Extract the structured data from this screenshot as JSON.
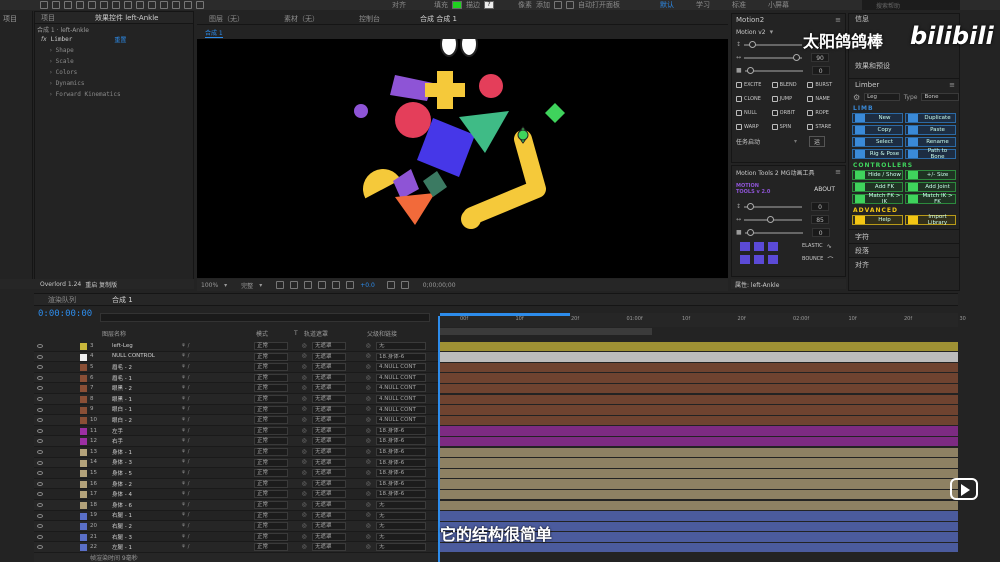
{
  "toolbar": {
    "align_label": "对齐",
    "fill_label": "填充",
    "stroke_label": "描边",
    "stroke_value": "?",
    "pixel_label": "像素",
    "add_label": "添加",
    "auto_open_label": "自动打开面板",
    "workspace_default": "默认",
    "workspace_learn": "学习",
    "workspace_standard": "标准",
    "workspace_small": "小屏幕",
    "search_placeholder": "搜索帮助",
    "fill_color": "#1fd31f"
  },
  "project_panel": {
    "tab_project": "项目",
    "tab_effects": "效果控件 left-Ankle",
    "breadcrumb": "合成 1 · left-Ankle",
    "fx_name": "Limber",
    "reset_label": "重置",
    "groups": [
      "Shape",
      "Scale",
      "Colors",
      "Dynamics",
      "Forward Kinematics"
    ]
  },
  "viewer_tabs": {
    "layer": "图层（无）",
    "footage": "素材（无）",
    "console": "控制台",
    "comp": "合成 合成 1",
    "comp_chip": "合成 1"
  },
  "viewer_bar": {
    "zoom": "100%",
    "quality": "完整",
    "exposure": "+0.0",
    "timecode": "0;00;00;00"
  },
  "overlord": {
    "label": "Overlord 1.24",
    "label2": "重启 复制版"
  },
  "motion2": {
    "title": "Motion2",
    "preset": "Motion v2",
    "values": [
      "0",
      "90",
      "0"
    ],
    "buttons": [
      "EXCITE",
      "BLEND",
      "BURST",
      "CLONE",
      "JUMP",
      "NAME",
      "NULL",
      "ORBIT",
      "ROPE",
      "WARP",
      "SPIN",
      "STARE"
    ],
    "task_label": "任务启动",
    "task_button": "运"
  },
  "mt2": {
    "title": "Motion Tools 2 MG动画工具",
    "logo_line1": "MOTION",
    "logo_line2": "TOOLS v 2.0",
    "about": "ABOUT",
    "values": [
      "0",
      "85",
      "0"
    ],
    "elastic": "ELASTIC",
    "bounce": "BOUNCE",
    "footer": "属性: left-Ankle"
  },
  "right_column": {
    "info": "信息",
    "search_placeholder": "搜索帮助",
    "effects_presets": "效果和预设",
    "limber": "Limber",
    "leg_select": "Leg",
    "type_label": "Type",
    "type_select": "Bone",
    "section_limb": "LIMB",
    "section_controllers": "CONTROLLERS",
    "section_advanced": "ADVANCED",
    "buttons_limb": [
      "New",
      "Duplicate",
      "Copy",
      "Paste",
      "Select",
      "Rename",
      "Rig & Pose",
      "Path to Bone"
    ],
    "buttons_controllers": [
      "Hide / Show",
      "+/- Size",
      "Add FK",
      "Add Joint",
      "Match FK > IK",
      "Match IK > FK"
    ],
    "buttons_advanced": [
      "Help",
      "Import Library"
    ],
    "char_label": "字符",
    "para_label": "段落",
    "align_label": "对齐"
  },
  "timeline": {
    "tab_render": "渲染队列",
    "tab_comp": "合成 1",
    "timecode": "0:00:00:00",
    "col_name": "图层名称",
    "col_mode": "模式",
    "col_t": "T",
    "col_trkmat": "轨道遮罩",
    "col_parent": "父级和链接",
    "footer": "帧渲染时间  9毫秒",
    "ruler": [
      "00f",
      "10f",
      "20f",
      "01:00f",
      "10f",
      "20f",
      "02:00f",
      "10f",
      "20f",
      "30"
    ],
    "layers": [
      {
        "num": "3",
        "name": "left-Leg",
        "color": "#c9b73b",
        "mode": "正常",
        "trk": "无遮罩",
        "parent": "无"
      },
      {
        "num": "4",
        "name": "NULL CONTROL",
        "color": "#f0f0f0",
        "mode": "正常",
        "trk": "无遮罩",
        "parent": "18.身体-6"
      },
      {
        "num": "5",
        "name": "眉毛 - 2",
        "color": "#8a4f36",
        "mode": "正常",
        "trk": "无遮罩",
        "parent": "4.NULL CONT"
      },
      {
        "num": "6",
        "name": "眉毛 - 1",
        "color": "#8a4f36",
        "mode": "正常",
        "trk": "无遮罩",
        "parent": "4.NULL CONT"
      },
      {
        "num": "7",
        "name": "眼黑 - 2",
        "color": "#8a4f36",
        "mode": "正常",
        "trk": "无遮罩",
        "parent": "4.NULL CONT"
      },
      {
        "num": "8",
        "name": "眼黑 - 1",
        "color": "#8a4f36",
        "mode": "正常",
        "trk": "无遮罩",
        "parent": "4.NULL CONT"
      },
      {
        "num": "9",
        "name": "眼白 - 1",
        "color": "#8a4f36",
        "mode": "正常",
        "trk": "无遮罩",
        "parent": "4.NULL CONT"
      },
      {
        "num": "10",
        "name": "眼白 - 2",
        "color": "#8a4f36",
        "mode": "正常",
        "trk": "无遮罩",
        "parent": "4.NULL CONT"
      },
      {
        "num": "11",
        "name": "左手",
        "color": "#9c2fa3",
        "mode": "正常",
        "trk": "无遮罩",
        "parent": "18.身体-6"
      },
      {
        "num": "12",
        "name": "右手",
        "color": "#9c2fa3",
        "mode": "正常",
        "trk": "无遮罩",
        "parent": "18.身体-6"
      },
      {
        "num": "13",
        "name": "身体 - 1",
        "color": "#b3a27a",
        "mode": "正常",
        "trk": "无遮罩",
        "parent": "18.身体-6"
      },
      {
        "num": "14",
        "name": "身体 - 3",
        "color": "#b3a27a",
        "mode": "正常",
        "trk": "无遮罩",
        "parent": "18.身体-6"
      },
      {
        "num": "15",
        "name": "身体 - 5",
        "color": "#b3a27a",
        "mode": "正常",
        "trk": "无遮罩",
        "parent": "18.身体-6"
      },
      {
        "num": "16",
        "name": "身体 - 2",
        "color": "#b3a27a",
        "mode": "正常",
        "trk": "无遮罩",
        "parent": "18.身体-6"
      },
      {
        "num": "17",
        "name": "身体 - 4",
        "color": "#b3a27a",
        "mode": "正常",
        "trk": "无遮罩",
        "parent": "18.身体-6"
      },
      {
        "num": "18",
        "name": "身体 - 6",
        "color": "#b3a27a",
        "mode": "正常",
        "trk": "无遮罩",
        "parent": "无"
      },
      {
        "num": "19",
        "name": "右腿 - 1",
        "color": "#5a6fc7",
        "mode": "正常",
        "trk": "无遮罩",
        "parent": "无"
      },
      {
        "num": "20",
        "name": "右腿 - 2",
        "color": "#5a6fc7",
        "mode": "正常",
        "trk": "无遮罩",
        "parent": "无"
      },
      {
        "num": "21",
        "name": "右腿 - 3",
        "color": "#5a6fc7",
        "mode": "正常",
        "trk": "无遮罩",
        "parent": "无"
      },
      {
        "num": "22",
        "name": "左腿 - 1",
        "color": "#5a6fc7",
        "mode": "正常",
        "trk": "无遮罩",
        "parent": "无"
      }
    ]
  },
  "overlay": {
    "subtitle": "它的结构很简单",
    "watermark": "太阳鸽鸽棒",
    "logo": "bilibili"
  }
}
